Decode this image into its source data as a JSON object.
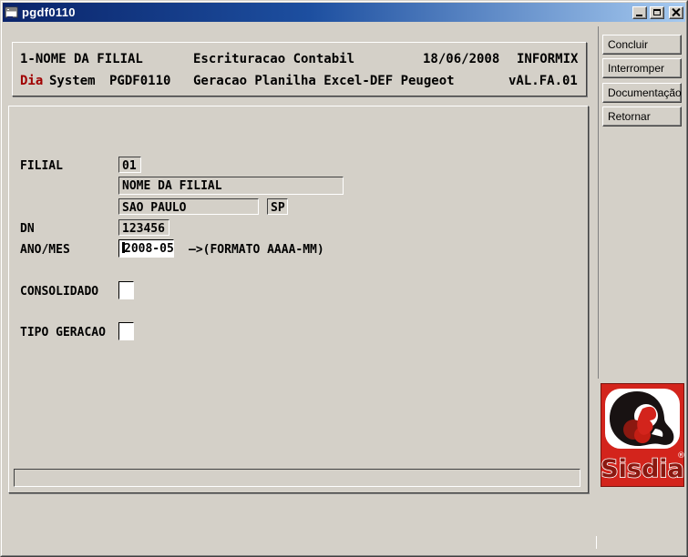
{
  "window": {
    "title": "pgdf0110"
  },
  "header": {
    "row1": {
      "screen_name": "1-NOME DA FILIAL",
      "module": "Escrituracao Contabil",
      "date": "18/06/2008",
      "database": "INFORMIX"
    },
    "row2": {
      "dia": "Dia",
      "system": "System",
      "program": "PGDF0110",
      "description": "Geracao Planilha Excel-DEF Peugeot",
      "version": "vAL.FA.01"
    }
  },
  "form": {
    "filial": {
      "label": "FILIAL",
      "code": "01",
      "name": "NOME DA FILIAL",
      "city": "SAO PAULO",
      "state": "SP"
    },
    "dn": {
      "label": "DN",
      "value": "123456"
    },
    "ano_mes": {
      "label": "ANO/MES",
      "value": "2008-05",
      "hint": "—>(FORMATO AAAA-MM)"
    },
    "consolidado": {
      "label": "CONSOLIDADO",
      "value": ""
    },
    "tipo_geracao": {
      "label": "TIPO GERACAO",
      "value": ""
    },
    "status_message": ""
  },
  "actions": {
    "concluir": "Concluir",
    "interromper": "Interromper",
    "documentacao": "Documentação",
    "retornar": "Retornar"
  },
  "logo": {
    "text": "Sisdia",
    "registered": "®"
  },
  "colors": {
    "window_bg": "#d4d0c8",
    "titlebar_gradient_start": "#0a246a",
    "titlebar_gradient_end": "#a6caf0",
    "header_highlight_red": "#a00000",
    "logo_red": "#d3241c"
  }
}
